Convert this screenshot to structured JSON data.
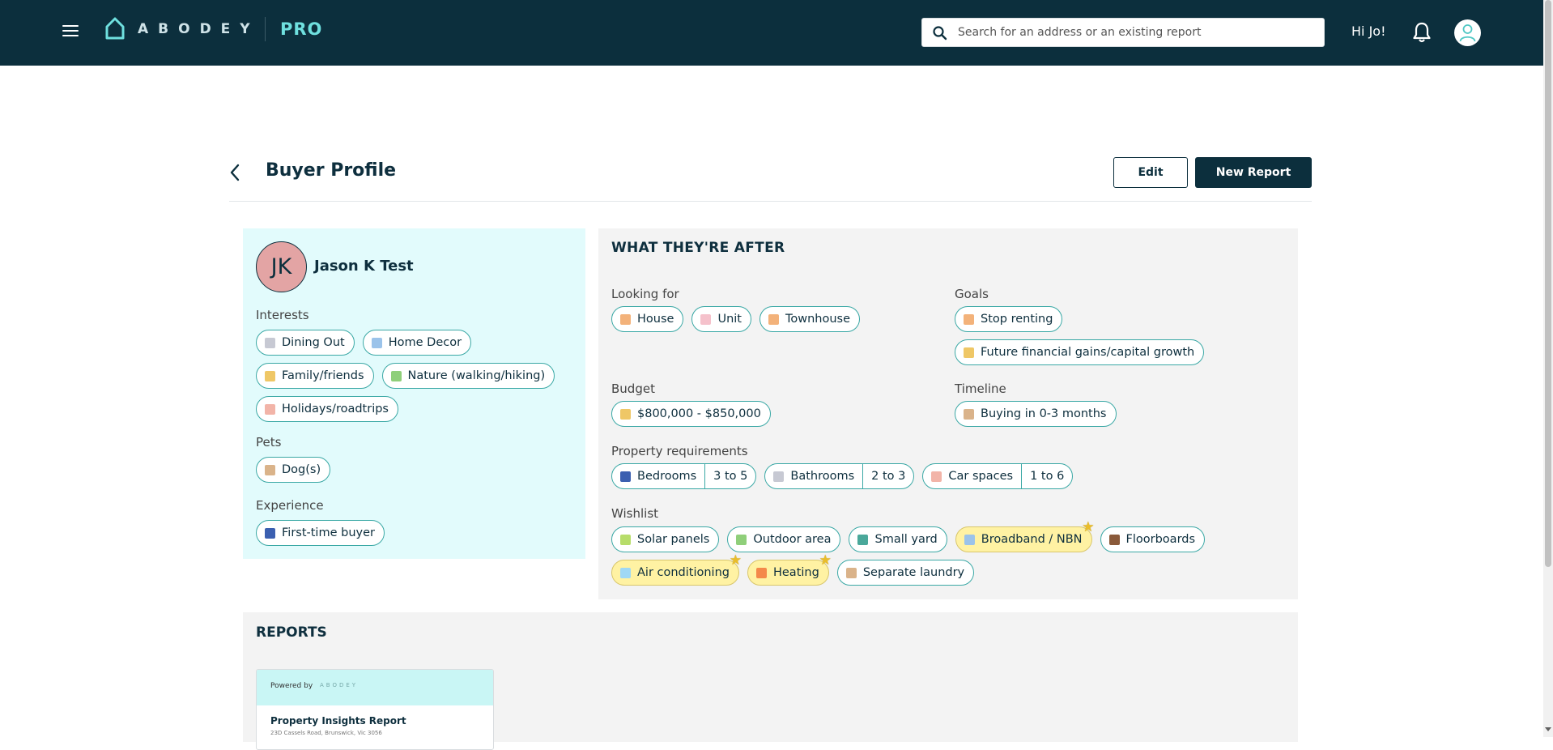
{
  "header": {
    "logo_text": "ABODEY",
    "logo_pro": "PRO",
    "search_placeholder": "Search for an address or an existing report",
    "greeting": "Hi Jo!"
  },
  "page": {
    "title": "Buyer Profile",
    "edit_label": "Edit",
    "new_report_label": "New Report"
  },
  "profile": {
    "initials": "JK",
    "name": "Jason K Test",
    "interests_label": "Interests",
    "interests": [
      {
        "label": "Dining Out",
        "icon": "dining-icon",
        "color": "#c7c9d3"
      },
      {
        "label": "Home Decor",
        "icon": "sofa-icon",
        "color": "#9bc3ea"
      },
      {
        "label": "Family/friends",
        "icon": "family-icon",
        "color": "#efc766"
      },
      {
        "label": "Nature (walking/hiking)",
        "icon": "tree-icon",
        "color": "#8fcf7a"
      },
      {
        "label": "Holidays/roadtrips",
        "icon": "beach-icon",
        "color": "#f2b4a8"
      }
    ],
    "pets_label": "Pets",
    "pets": [
      {
        "label": "Dog(s)",
        "icon": "dog-icon",
        "color": "#dab38a"
      }
    ],
    "experience_label": "Experience",
    "experience": [
      {
        "label": "First-time buyer",
        "icon": "new-badge-icon",
        "color": "#3b5fb0"
      }
    ]
  },
  "after": {
    "title": "WHAT THEY'RE AFTER",
    "looking_for_label": "Looking for",
    "looking_for": [
      {
        "label": "House",
        "icon": "house-icon"
      },
      {
        "label": "Unit",
        "icon": "building-icon"
      },
      {
        "label": "Townhouse",
        "icon": "townhouse-icon"
      }
    ],
    "goals_label": "Goals",
    "goals": [
      {
        "label": "Stop renting",
        "icon": "house-icon"
      },
      {
        "label": "Future financial gains/capital growth",
        "icon": "money-bag-icon"
      }
    ],
    "budget_label": "Budget",
    "budget": {
      "label": "$800,000 - $850,000",
      "icon": "money-bag-icon"
    },
    "timeline_label": "Timeline",
    "timeline": {
      "label": "Buying in 0-3 months",
      "icon": "hourglass-icon"
    },
    "requirements_label": "Property requirements",
    "requirements": [
      {
        "label": "Bedrooms",
        "count": "3 to 5",
        "icon": "bed-icon"
      },
      {
        "label": "Bathrooms",
        "count": "2 to 3",
        "icon": "bathtub-icon"
      },
      {
        "label": "Car spaces",
        "count": "1 to 6",
        "icon": "car-icon"
      }
    ],
    "wishlist_label": "Wishlist",
    "wishlist": [
      {
        "label": "Solar panels",
        "icon": "battery-icon",
        "fav": false
      },
      {
        "label": "Outdoor area",
        "icon": "plant-icon",
        "fav": false
      },
      {
        "label": "Small yard",
        "icon": "yard-icon",
        "fav": false
      },
      {
        "label": "Broadband / NBN",
        "icon": "globe-icon",
        "fav": true
      },
      {
        "label": "Floorboards",
        "icon": "wood-icon",
        "fav": false
      },
      {
        "label": "Air conditioning",
        "icon": "snowflake-icon",
        "fav": true
      },
      {
        "label": "Heating",
        "icon": "flame-icon",
        "fav": true
      },
      {
        "label": "Separate laundry",
        "icon": "basket-icon",
        "fav": false
      }
    ]
  },
  "reports": {
    "title": "REPORTS",
    "items": [
      {
        "powered_by": "Powered by",
        "brand": "ABODEY",
        "title": "Property Insights Report",
        "address": "23D Cassels Road, Brunswick, Vic 3056"
      }
    ]
  }
}
